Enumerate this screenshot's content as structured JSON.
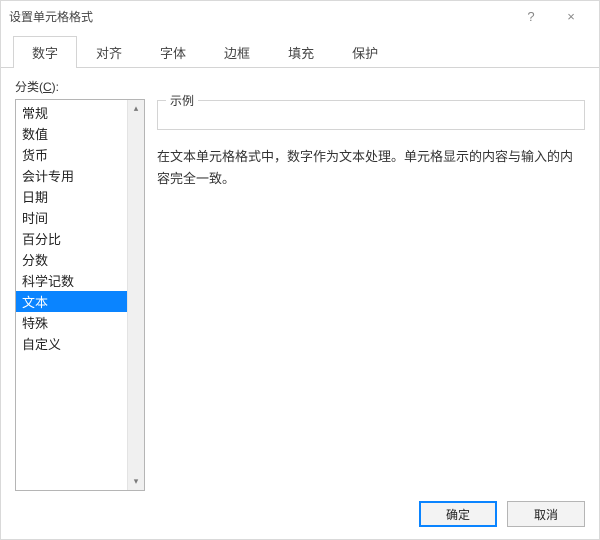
{
  "window": {
    "title": "设置单元格格式",
    "help": "?",
    "close": "×"
  },
  "tabs": [
    "数字",
    "对齐",
    "字体",
    "边框",
    "填充",
    "保护"
  ],
  "active_tab_index": 0,
  "category": {
    "label_prefix": "分类(",
    "label_key": "C",
    "label_suffix": "):",
    "items": [
      "常规",
      "数值",
      "货币",
      "会计专用",
      "日期",
      "时间",
      "百分比",
      "分数",
      "科学记数",
      "文本",
      "特殊",
      "自定义"
    ],
    "selected_index": 9
  },
  "sample": {
    "legend": "示例",
    "value": ""
  },
  "description": "在文本单元格格式中，数字作为文本处理。单元格显示的内容与输入的内容完全一致。",
  "buttons": {
    "ok": "确定",
    "cancel": "取消"
  },
  "scroll": {
    "up": "▴",
    "down": "▾"
  }
}
